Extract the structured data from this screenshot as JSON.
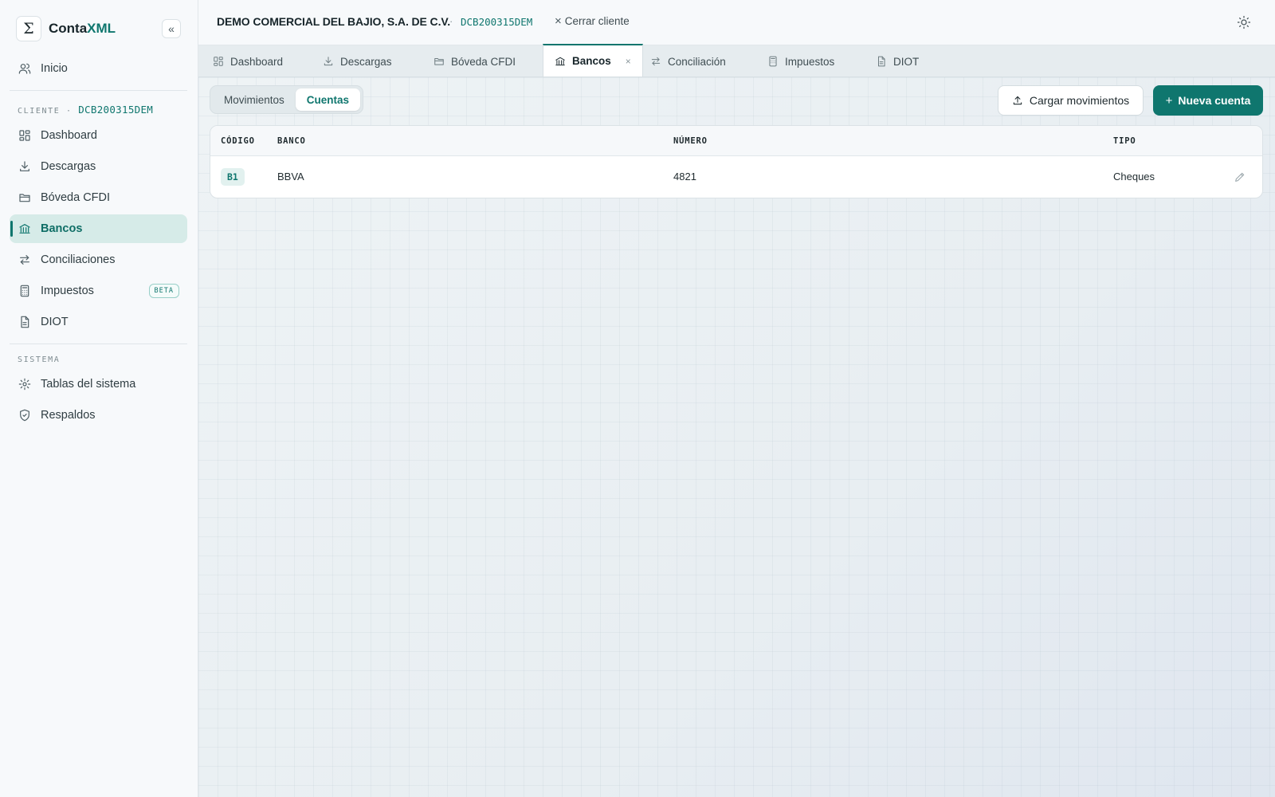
{
  "brand": {
    "name_part1": "Conta",
    "name_part2": "XML",
    "logo_glyph": "Σ",
    "collapse_glyph": "«"
  },
  "sidebar": {
    "home": {
      "label": "Inicio",
      "icon": "users-icon"
    },
    "client_section": {
      "label": "CLIENTE ·",
      "rfc": "DCB200315DEM"
    },
    "client_items": [
      {
        "label": "Dashboard",
        "icon": "dashboard-icon"
      },
      {
        "label": "Descargas",
        "icon": "download-icon"
      },
      {
        "label": "Bóveda CFDI",
        "icon": "folder-icon"
      },
      {
        "label": "Bancos",
        "icon": "bank-icon",
        "active": true
      },
      {
        "label": "Conciliaciones",
        "icon": "arrows-icon"
      },
      {
        "label": "Impuestos",
        "icon": "calculator-icon",
        "badge": "BETA"
      },
      {
        "label": "DIOT",
        "icon": "file-icon"
      }
    ],
    "system_section": {
      "label": "SISTEMA"
    },
    "system_items": [
      {
        "label": "Tablas del sistema",
        "icon": "gear-icon"
      },
      {
        "label": "Respaldos",
        "icon": "shield-icon"
      }
    ]
  },
  "header": {
    "company": "DEMO COMERCIAL DEL BAJIO, S.A. DE C.V.",
    "separator": "·",
    "rfc": "DCB200315DEM",
    "close_label": "Cerrar cliente",
    "close_glyph": "×"
  },
  "tabs": [
    {
      "label": "Dashboard",
      "icon": "dashboard-icon"
    },
    {
      "label": "Descargas",
      "icon": "download-icon"
    },
    {
      "label": "Bóveda CFDI",
      "icon": "folder-icon"
    },
    {
      "label": "Bancos",
      "icon": "bank-icon",
      "active": true,
      "close_glyph": "×"
    },
    {
      "label": "Conciliación",
      "icon": "arrows-icon"
    },
    {
      "label": "Impuestos",
      "icon": "calculator-icon"
    },
    {
      "label": "DIOT",
      "icon": "file-icon"
    }
  ],
  "main": {
    "segments": [
      {
        "label": "Movimientos",
        "active": false
      },
      {
        "label": "Cuentas",
        "active": true
      }
    ],
    "upload_button": "Cargar movimientos",
    "new_button": {
      "plus": "+",
      "label": "Nueva cuenta"
    },
    "table": {
      "headers": [
        "CÓDIGO",
        "BANCO",
        "NÚMERO",
        "TIPO"
      ],
      "rows": [
        {
          "codigo": "B1",
          "banco": "BBVA",
          "numero": "4821",
          "tipo": "Cheques"
        }
      ]
    }
  },
  "colors": {
    "accent": "#0f766e",
    "active_bg": "#d6ebe8",
    "sidebar_bg": "#f7f9fb"
  }
}
